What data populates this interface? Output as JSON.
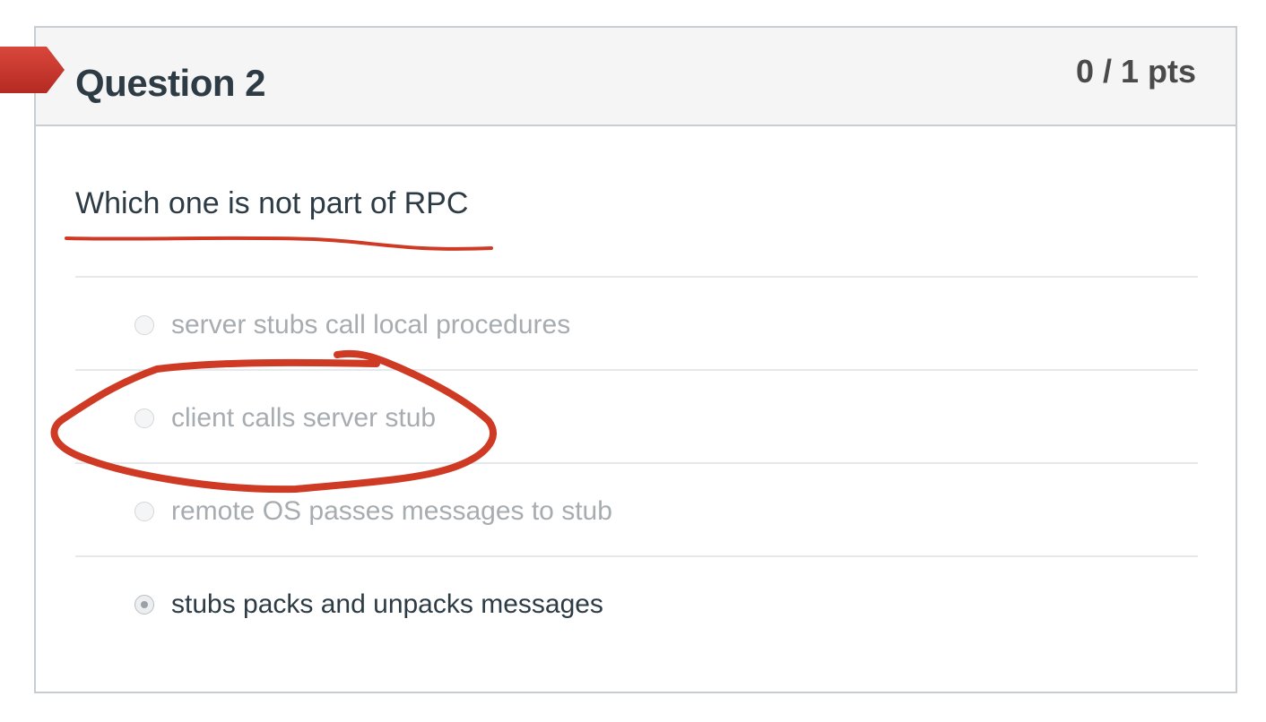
{
  "question": {
    "title": "Question 2",
    "points": "0 / 1 pts",
    "text": "Which one is not part of RPC"
  },
  "answers": [
    {
      "label": "server stubs call local procedures",
      "selected": false
    },
    {
      "label": "client calls server stub",
      "selected": false
    },
    {
      "label": "remote OS passes messages to stub",
      "selected": false
    },
    {
      "label": "stubs packs and unpacks messages",
      "selected": true
    }
  ],
  "colors": {
    "flag": "#c9362c",
    "annotation": "#cf3a24",
    "title_text": "#2d3b45",
    "muted_text": "#a7acb0"
  }
}
